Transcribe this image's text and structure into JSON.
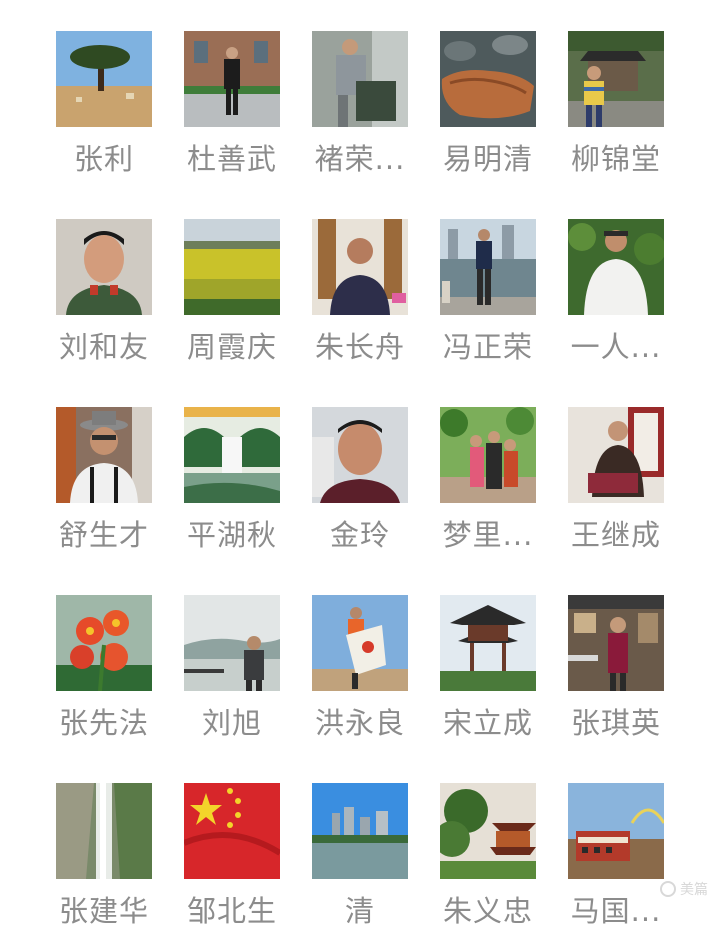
{
  "contacts": [
    {
      "name": "张利",
      "icon": "landscape-tree-avatar"
    },
    {
      "name": "杜善武",
      "icon": "man-standing-avatar"
    },
    {
      "name": "褚荣...",
      "icon": "man-working-avatar"
    },
    {
      "name": "易明清",
      "icon": "rock-avatar"
    },
    {
      "name": "柳锦堂",
      "icon": "man-pavilion-avatar"
    },
    {
      "name": "刘和友",
      "icon": "portrait-soldier-avatar"
    },
    {
      "name": "周霞庆",
      "icon": "rapeseed-field-avatar"
    },
    {
      "name": "朱长舟",
      "icon": "man-indoor-avatar"
    },
    {
      "name": "冯正荣",
      "icon": "man-riverside-avatar"
    },
    {
      "name": "一人...",
      "icon": "man-garden-avatar"
    },
    {
      "name": "舒生才",
      "icon": "man-hat-avatar"
    },
    {
      "name": "平湖秋",
      "icon": "waterfall-painting-avatar"
    },
    {
      "name": "金玲",
      "icon": "man-closeup-avatar"
    },
    {
      "name": "梦里...",
      "icon": "group-garden-avatar"
    },
    {
      "name": "王继成",
      "icon": "woman-seated-avatar"
    },
    {
      "name": "张先法",
      "icon": "red-flowers-avatar"
    },
    {
      "name": "刘旭",
      "icon": "man-lake-avatar"
    },
    {
      "name": "洪永良",
      "icon": "man-flag-avatar"
    },
    {
      "name": "宋立成",
      "icon": "pagoda-avatar"
    },
    {
      "name": "张琪英",
      "icon": "woman-street-avatar"
    },
    {
      "name": "张建华",
      "icon": "waterfall-avatar"
    },
    {
      "name": "邹北生",
      "icon": "china-flag-avatar"
    },
    {
      "name": "清",
      "icon": "city-river-avatar"
    },
    {
      "name": "朱义忠",
      "icon": "temple-trees-avatar"
    },
    {
      "name": "马国...",
      "icon": "palace-avatar"
    }
  ],
  "watermark": "美篇"
}
